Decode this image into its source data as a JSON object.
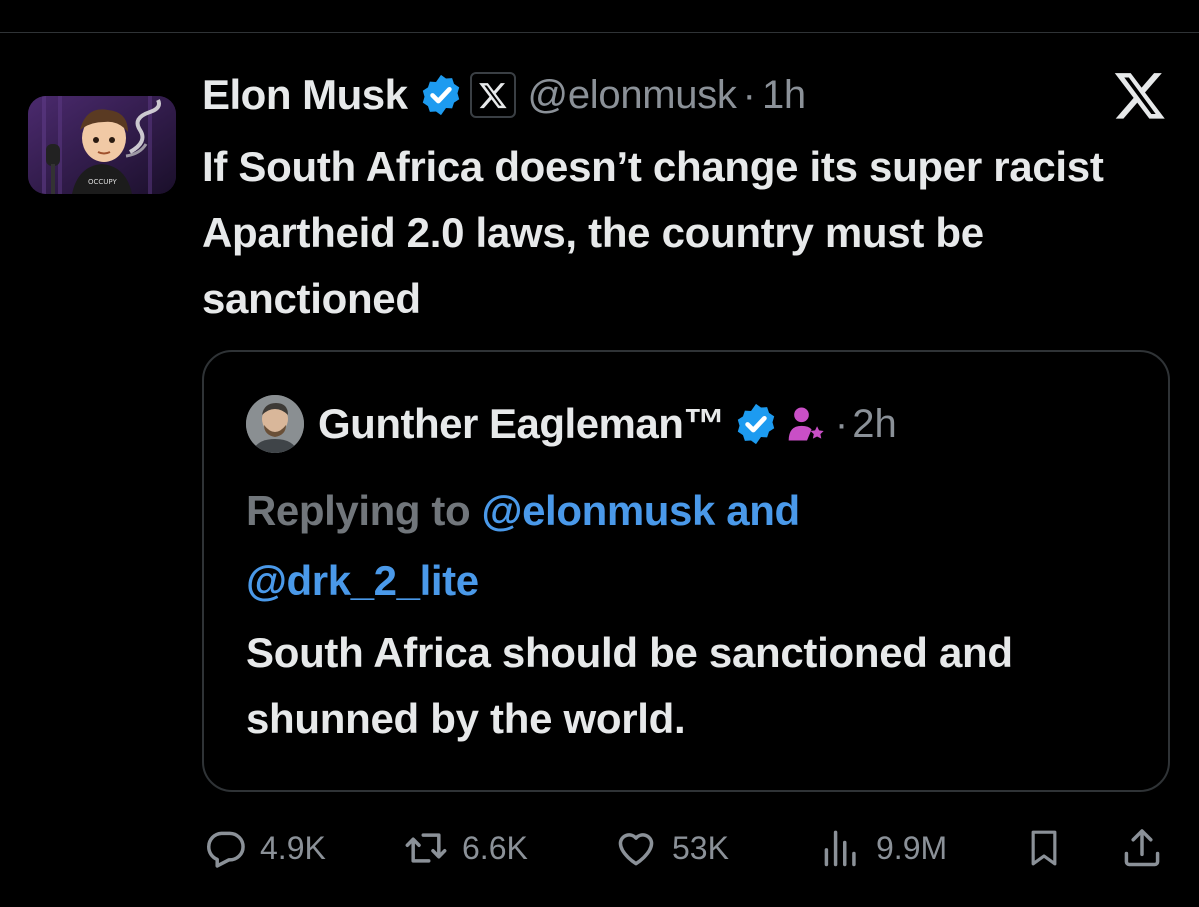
{
  "post": {
    "author_name": "Elon Musk",
    "handle": "@elonmusk",
    "separator": "·",
    "time": "1h",
    "text": "If South Africa doesn’t change its super racist Apartheid 2.0 laws, the country must be sanctioned"
  },
  "quote": {
    "author_name": "Gunther Eagleman™",
    "separator": "·",
    "time": "2h",
    "replying_prefix": "Replying to ",
    "mention_1": "@elonmusk",
    "conjunction": "and",
    "mention_2": "@drk_2_lite",
    "text": "South Africa should be sanctioned and shunned by the world."
  },
  "actions": {
    "replies": "4.9K",
    "reposts": "6.6K",
    "likes": "53K",
    "views": "9.9M"
  },
  "icons": [
    "verified-badge-icon",
    "x-affiliation-icon",
    "x-logo-icon",
    "reply-icon",
    "repost-icon",
    "like-icon",
    "views-icon",
    "bookmark-icon",
    "share-icon",
    "subscriber-person-icon"
  ],
  "colors": {
    "background": "#000000",
    "text": "#e7e9ea",
    "muted": "#71767b",
    "link": "#4a99e9",
    "verified": "#1d9bf0",
    "border": "#2f3336"
  }
}
